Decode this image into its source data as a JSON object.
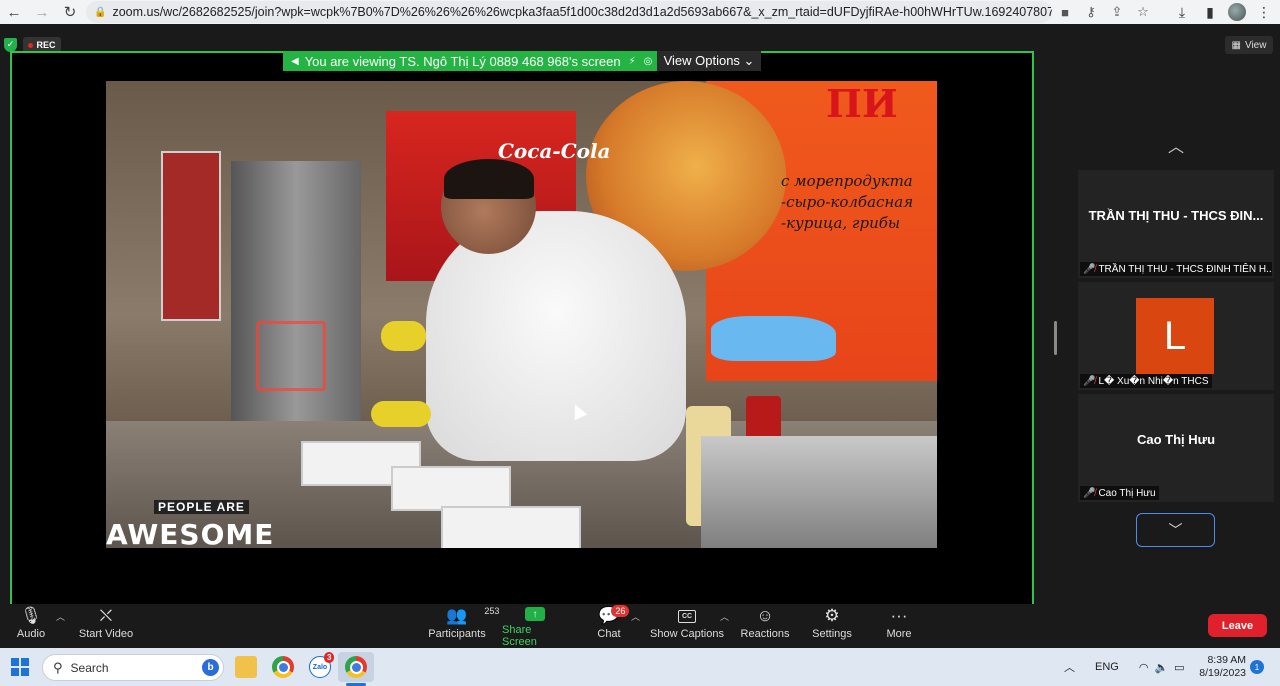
{
  "browser": {
    "url": "zoom.us/wc/2682682525/join?wpk=wcpk%7B0%7D%26%26%26%26wcpka3faa5f1d00c38d2d3d1a2d5693ab667&_x_zm_rtaid=dUFDyjfiRAe-h00hWHrTUw.1692407807976.7aedbe..."
  },
  "meeting": {
    "rec_label": "REC",
    "viewing_text": "You are viewing TS. Ngô Thị Lý 0889 468 968's screen",
    "view_options_label": "View Options ⌄",
    "view_label": "View"
  },
  "video": {
    "pizza_title": "ПИ",
    "pizza_text": "с морепродукта\n-сыро-колбасная\n-курица, грибы",
    "coke_text": "Coca-Cola",
    "logo_small": "PEOPLE ARE",
    "logo_big": "AWESOME"
  },
  "participants": [
    {
      "display": "TRẦN THỊ THU - THCS ĐIN...",
      "label": "TRẦN THỊ THU - THCS ĐINH TIÊN H..."
    },
    {
      "letter": "L",
      "label": "L� Xu�n Nhi�n THCS"
    },
    {
      "display": "Cao Thị Hưu",
      "label": "Cao Thị Hưu"
    }
  ],
  "toolbar": {
    "audio": "Audio",
    "start_video": "Start Video",
    "participants": "Participants",
    "participants_count": "253",
    "share_screen": "Share Screen",
    "chat": "Chat",
    "chat_badge": "26",
    "captions": "Show Captions",
    "reactions": "Reactions",
    "settings": "Settings",
    "more": "More",
    "leave": "Leave",
    "cc_icon": "CC"
  },
  "taskbar": {
    "search_placeholder": "Search",
    "zalo_label": "Zalo",
    "zalo_badge": "3",
    "language": "ENG",
    "time": "8:39 AM",
    "date": "8/19/2023",
    "notifications": "1"
  },
  "colors": {
    "share_green": "#33c34b",
    "leave_red": "#e0202b",
    "avatar_orange": "#d9460f"
  }
}
